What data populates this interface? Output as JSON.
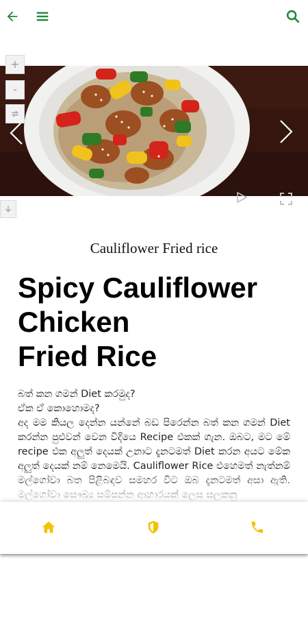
{
  "header": {
    "back_icon": "arrow-left-icon",
    "menu_icon": "hamburger-menu-icon",
    "search_icon": "search-icon",
    "accent_color": "#1e8a3c"
  },
  "gallery": {
    "zoom_in": "+",
    "zoom_out": "-",
    "icons": [
      "zoom-in-icon",
      "zoom-out-icon",
      "rotate-icon",
      "chevron-left-icon",
      "chevron-right-icon",
      "play-icon",
      "fullscreen-icon",
      "download-icon"
    ]
  },
  "article": {
    "caption": "Cauliflower Fried rice",
    "title_lines": [
      "Spicy Cauliflower",
      "Chicken",
      "Fried Rice"
    ],
    "paragraphs": [
      "බත් කන ගමන් Diet කරමුද?",
      "ඒක ඒ කොහොමද?",
      "අද මම කියල දෙන්න යන්නේ බඩ පිරෙන්න බත් කන ගමන් Diet කරන්න පුළුවන් වෙන විදියෙ Recipe එකක් ගැන. ඔබට, මට මේ recipe එක අලුත් දෙයක් උනාට දැනටමත් Diet කරන අයට මේක අලුත් දෙයක් නම් නෙමෙයි. Cauliflower Rice එහෙමත් නැත්නම් මල්ගෝවා බත පිළිබඳව සමහර විට ඔබ දැනටමත් අසා ඇති. මල්ගෝවා සෞඛ්‍ය සම්පන්න ආහාරයක් ලෙස සලකනු"
    ]
  },
  "bottom_nav": {
    "icons": [
      "home-icon",
      "shield-icon",
      "phone-icon"
    ],
    "accent_color": "#f2c200"
  }
}
